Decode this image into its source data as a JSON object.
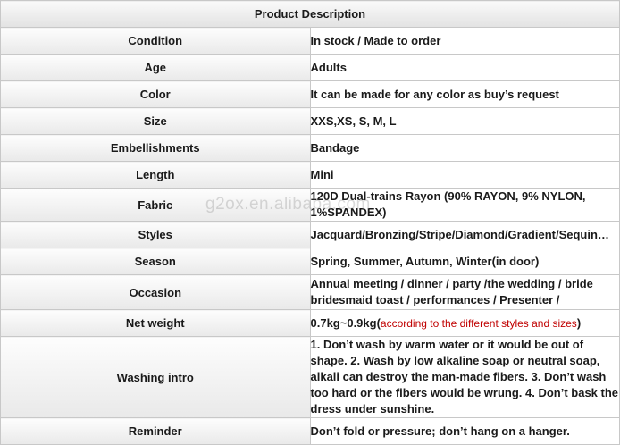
{
  "title": "Product Description",
  "rows": [
    {
      "label": "Condition",
      "value": "In stock / Made to order"
    },
    {
      "label": "Age",
      "value": "Adults"
    },
    {
      "label": "Color",
      "value": "It can be made for any color as buy’s request"
    },
    {
      "label": "Size",
      "value": "XXS,XS, S, M, L"
    },
    {
      "label": "Embellishments",
      "value": "Bandage"
    },
    {
      "label": "Length",
      "value": "Mini"
    },
    {
      "label": "Fabric",
      "value": "120D Dual-trains Rayon (90% RAYON, 9% NYLON, 1%SPANDEX)"
    },
    {
      "label": "Styles",
      "value": "Jacquard/Bronzing/Stripe/Diamond/Gradient/Sequin…"
    },
    {
      "label": "Season",
      "value": "Spring, Summer, Autumn, Winter(in door)"
    },
    {
      "label": "Occasion",
      "value": "Annual meeting / dinner / party /the wedding / bride bridesmaid toast / performances / Presenter /"
    },
    {
      "label": "Net weight",
      "value": "0.7kg~0.9kg(",
      "note": "according to the different styles and sizes",
      "close": ")"
    },
    {
      "label": "Washing intro",
      "value": "1. Don’t wash by warm water or it would be out of shape. 2. Wash by low alkaline soap or neutral soap, alkali can destroy the man-made fibers. 3. Don’t wash too hard or the fibers would be wrung. 4. Don’t bask the dress under sunshine."
    },
    {
      "label": "Reminder",
      "value": "Don’t fold or pressure; don’t hang on a hanger."
    }
  ],
  "watermark": "g2ox.en.alibaba.com"
}
